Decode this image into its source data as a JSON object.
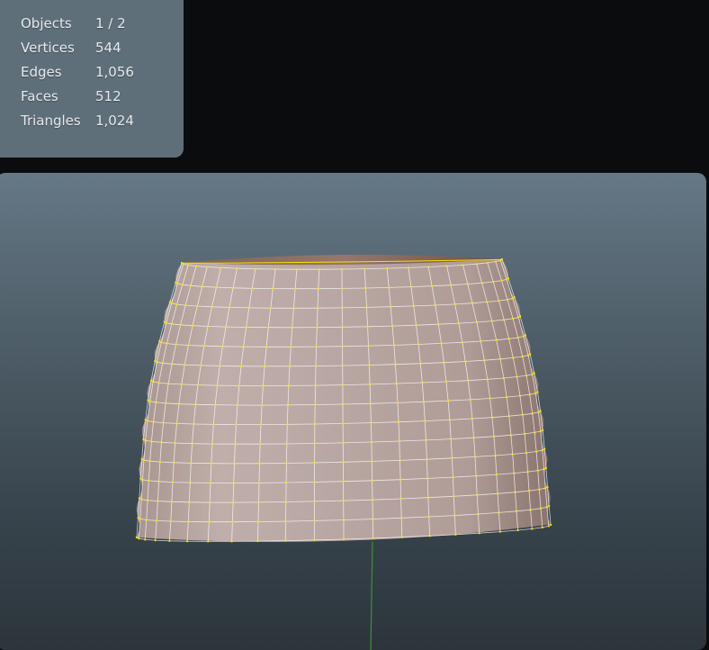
{
  "stats_overlay": {
    "rows": [
      {
        "label": "Objects",
        "value": "1 / 2"
      },
      {
        "label": "Vertices",
        "value": "544"
      },
      {
        "label": "Edges",
        "value": "1,056"
      },
      {
        "label": "Faces",
        "value": "512"
      },
      {
        "label": "Triangles",
        "value": "1,024"
      }
    ]
  },
  "viewport": {
    "mesh_color": "#b9a7a2",
    "wire_color": "#ffffff",
    "vertex_color": "#ffe000",
    "axis_color": "#3f9a3f"
  }
}
